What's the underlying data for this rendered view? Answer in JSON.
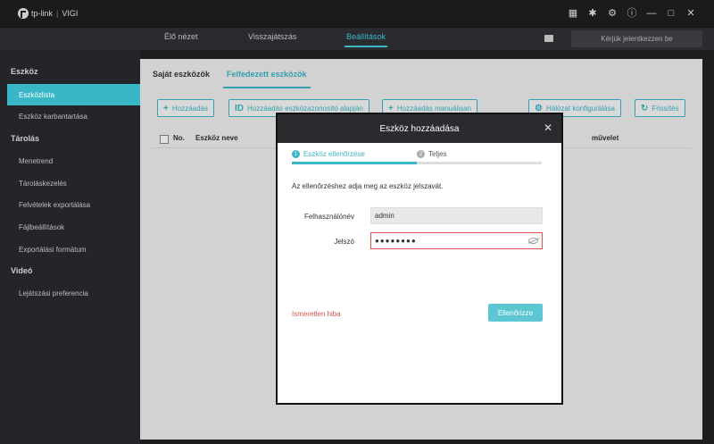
{
  "app": {
    "brand": "tp-link",
    "product": "VIGI"
  },
  "window_icons": [
    "grid-icon",
    "bug-icon",
    "gear-icon",
    "info-icon",
    "minimize-icon",
    "maximize-icon",
    "close-icon"
  ],
  "topnav": {
    "tabs": [
      {
        "label": "Élő nézet"
      },
      {
        "label": "Visszajátszás"
      },
      {
        "label": "Beállítások",
        "active": true
      }
    ],
    "login_label": "Kérjük jelentkezzen be"
  },
  "sidebar": {
    "groups": [
      {
        "label": "Eszköz",
        "items": [
          {
            "label": "Eszközlista",
            "active": true
          },
          {
            "label": "Eszköz karbantartása"
          }
        ]
      },
      {
        "label": "Tárolás",
        "items": [
          {
            "label": "Menetrend"
          },
          {
            "label": "Tároláskezelés"
          },
          {
            "label": "Felvételek exportálása"
          },
          {
            "label": "Fájlbeállítások"
          },
          {
            "label": "Exportálási formátum"
          }
        ]
      },
      {
        "label": "Videó",
        "items": [
          {
            "label": "Lejátszási preferencia"
          }
        ]
      }
    ]
  },
  "main": {
    "subtabs": [
      {
        "label": "Saját eszközök"
      },
      {
        "label": "Felfedezett eszközök",
        "active": true
      }
    ],
    "toolbar": {
      "add": "Hozzáadás",
      "add_by_id": "Hozzáadás eszközazonosító alapján",
      "add_manual": "Hozzáadás manuálisan",
      "network_config": "Hálózat konfigurálása",
      "refresh": "Frissítés"
    },
    "table": {
      "headers": [
        "No.",
        "Eszköz neve",
        "művelet"
      ]
    }
  },
  "modal": {
    "title": "Eszköz hozzáadása",
    "steps": [
      {
        "label": "Eszköz ellenőrzése",
        "number": "1"
      },
      {
        "label": "Teljes",
        "number": "2"
      }
    ],
    "step_progress": 0.5,
    "prompt": "Az ellenőrzéshez adja meg az eszköz jelszavát.",
    "username_label": "Felhasználónév",
    "username_value": "admin",
    "password_label": "Jelszó",
    "password_value": "●●●●●●●●",
    "error_text": "Ismeretlen hiba",
    "verify_label": "Ellenőrizze"
  },
  "colors": {
    "accent": "#3ab7c7",
    "error": "#d9534f",
    "header": "#2a2b2e"
  }
}
